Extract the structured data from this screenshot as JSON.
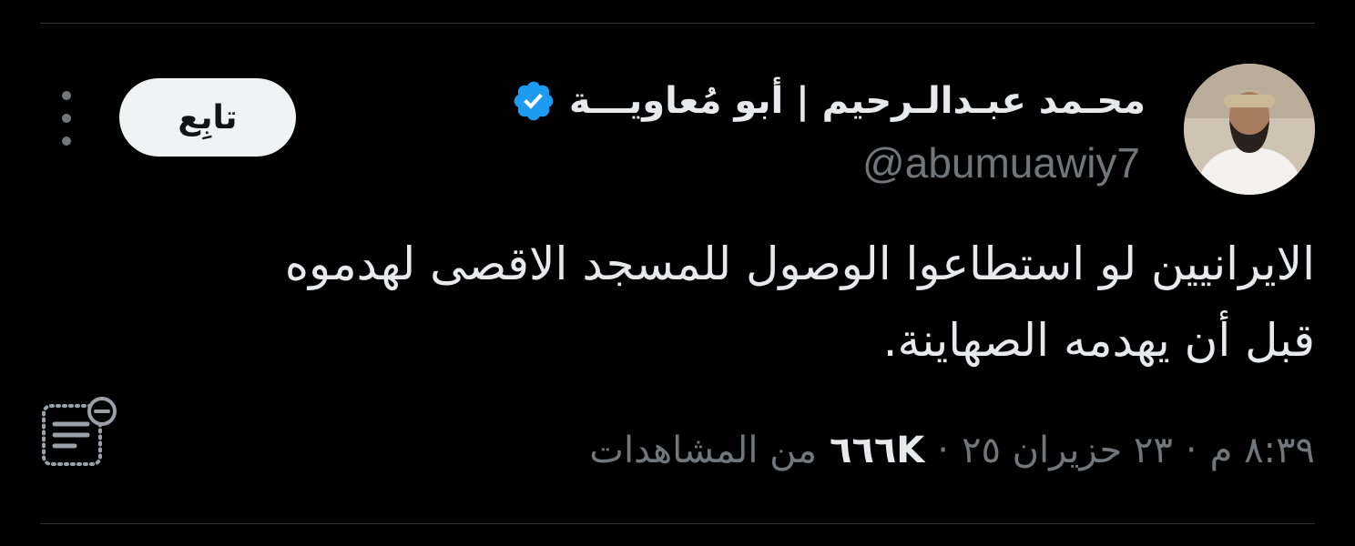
{
  "author": {
    "display_name": "محـمد عبـدالـرحيم | أبو مُعاويـــة",
    "handle": "@abumuawiy7",
    "verified_icon": "verified-badge-icon",
    "avatar_icon": "avatar"
  },
  "follow_label": "تابِع",
  "tweet": {
    "line_1": "الايرانيين لو استطاعوا الوصول للمسجد الاقصى لهدموه",
    "line_2": "قبل أن يهدمه الصهاينة."
  },
  "meta": {
    "time": "٨:٣٩ م",
    "separator": "·",
    "date": "٢٣ حزيران ٢٥",
    "views_count": "٦٦٦K",
    "views_label": "من المشاهدات"
  },
  "colors": {
    "background": "#000000",
    "text": "#e7e9ea",
    "secondary_text": "#71767b",
    "verified_blue": "#1d9bf0",
    "divider": "#2f3336",
    "button_bg": "#eff3f4"
  },
  "icons": {
    "more": "more-options-icon",
    "notes": "community-notes-icon"
  }
}
